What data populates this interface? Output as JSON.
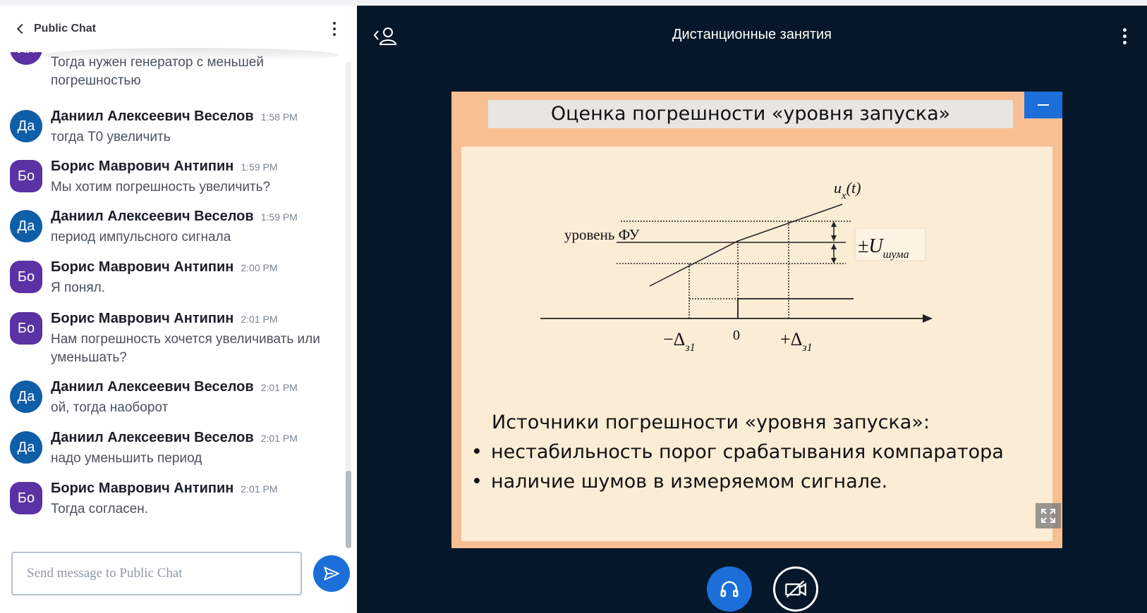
{
  "chat": {
    "title": "Public Chat",
    "input_placeholder": "Send message to Public Chat",
    "messages": [
      {
        "avatar": "Ил",
        "name": "",
        "time": "",
        "text": "Тогда нужен генератор с меньшей погрешностью"
      },
      {
        "avatar": "Да",
        "name": "Даниил Алексеевич Веселов",
        "time": "1:58 PM",
        "text": "тогда Т0 увеличить"
      },
      {
        "avatar": "Бо",
        "name": "Борис Маврович Антипин",
        "time": "1:59 PM",
        "text": "Мы хотим погрешность увеличить?"
      },
      {
        "avatar": "Да",
        "name": "Даниил Алексеевич Веселов",
        "time": "1:59 PM",
        "text": "период импульсного сигнала"
      },
      {
        "avatar": "Бо",
        "name": "Борис Маврович Антипин",
        "time": "2:00 PM",
        "text": "Я понял."
      },
      {
        "avatar": "Бо",
        "name": "Борис Маврович Антипин",
        "time": "2:01 PM",
        "text": "Нам погрешность хочется увеличивать или уменьшать?"
      },
      {
        "avatar": "Да",
        "name": "Даниил Алексеевич Веселов",
        "time": "2:01 PM",
        "text": "ой, тогда наоборот"
      },
      {
        "avatar": "Да",
        "name": "Даниил Алексеевич Веселов",
        "time": "2:01 PM",
        "text": "надо уменьшить период"
      },
      {
        "avatar": "Бо",
        "name": "Борис Маврович Антипин",
        "time": "2:01 PM",
        "text": "Тогда согласен."
      }
    ]
  },
  "stage": {
    "title": "Дистанционные занятия"
  },
  "slide": {
    "title": "Оценка погрешности «уровня запуска»",
    "diagram": {
      "curve_label": "u",
      "curve_label_sub": "x",
      "curve_label_arg": "(t)",
      "level_label": "уровень ФУ",
      "noise_label": "±U",
      "noise_label_sub": "шума",
      "x_minus": "−Δ",
      "x_minus_sub": "з1",
      "x_zero": "0",
      "x_plus": "+Δ",
      "x_plus_sub": "з1"
    },
    "sources_title": "Источники погрешности «уровня запуска»:",
    "bullets": [
      "нестабильность порог срабатывания компаратора",
      "наличие шумов в измеряемом сигнале."
    ]
  },
  "icons": {
    "back": "chevron-left-icon",
    "menu": "kebab-icon",
    "send": "send-icon",
    "user_toggle": "user-icon",
    "minimize": "minus-icon",
    "fullscreen": "fullscreen-icon",
    "audio": "headphones-icon",
    "video": "video-off-icon"
  },
  "colors": {
    "accent": "#1c6fd8",
    "stage_bg": "#06172a",
    "avatar_blue": "#0f5ea8",
    "avatar_purple": "#5a32a3",
    "slide_frame": "#f8bf93",
    "slide_panel": "#fbecd6"
  }
}
